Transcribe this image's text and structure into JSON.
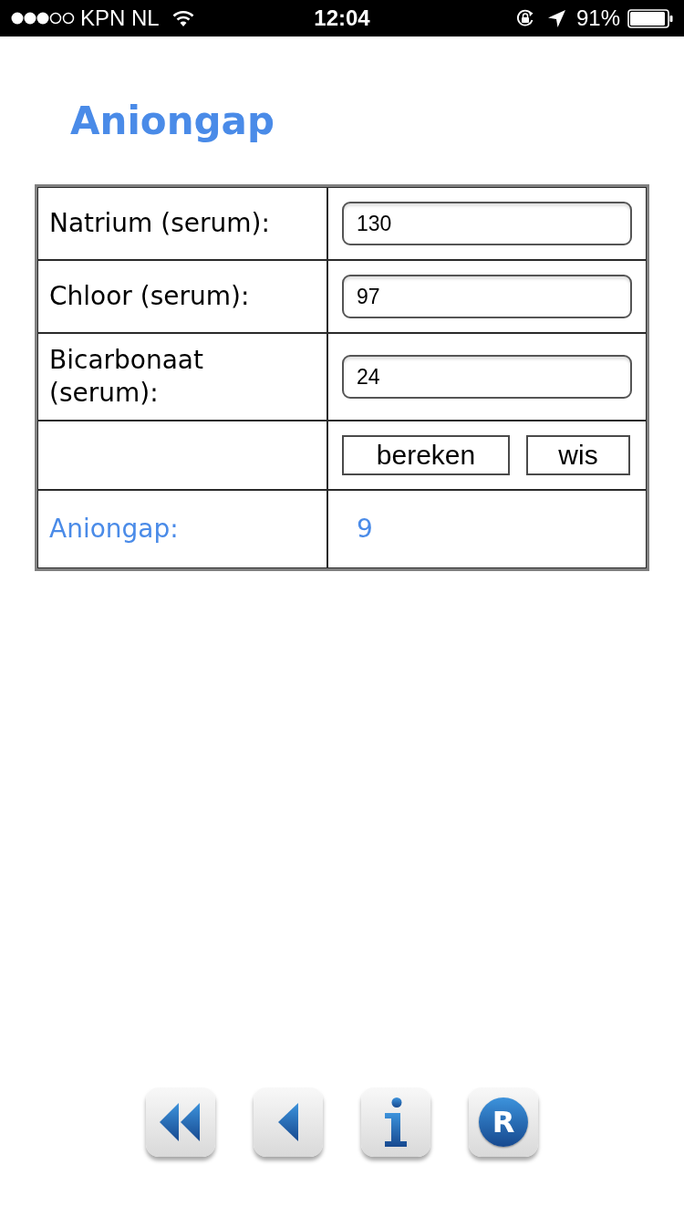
{
  "status_bar": {
    "carrier": "KPN NL",
    "time": "12:04",
    "battery": "91%"
  },
  "title": "Aniongap",
  "form": {
    "rows": [
      {
        "kind": "input",
        "label": "Natrium (serum):",
        "value": "130"
      },
      {
        "kind": "input",
        "label": "Chloor (serum):",
        "value": "97"
      },
      {
        "kind": "input",
        "label": "Bicarbonaat (serum):",
        "value": "24"
      },
      {
        "kind": "buttons",
        "buttons": [
          "bereken",
          "wis"
        ]
      },
      {
        "kind": "result",
        "label": "Aniongap:",
        "value": "9"
      }
    ]
  },
  "toolbar": {
    "buttons": [
      {
        "kind": "rewind"
      },
      {
        "kind": "back"
      },
      {
        "kind": "info"
      },
      {
        "kind": "letter",
        "letter": "R"
      }
    ]
  }
}
